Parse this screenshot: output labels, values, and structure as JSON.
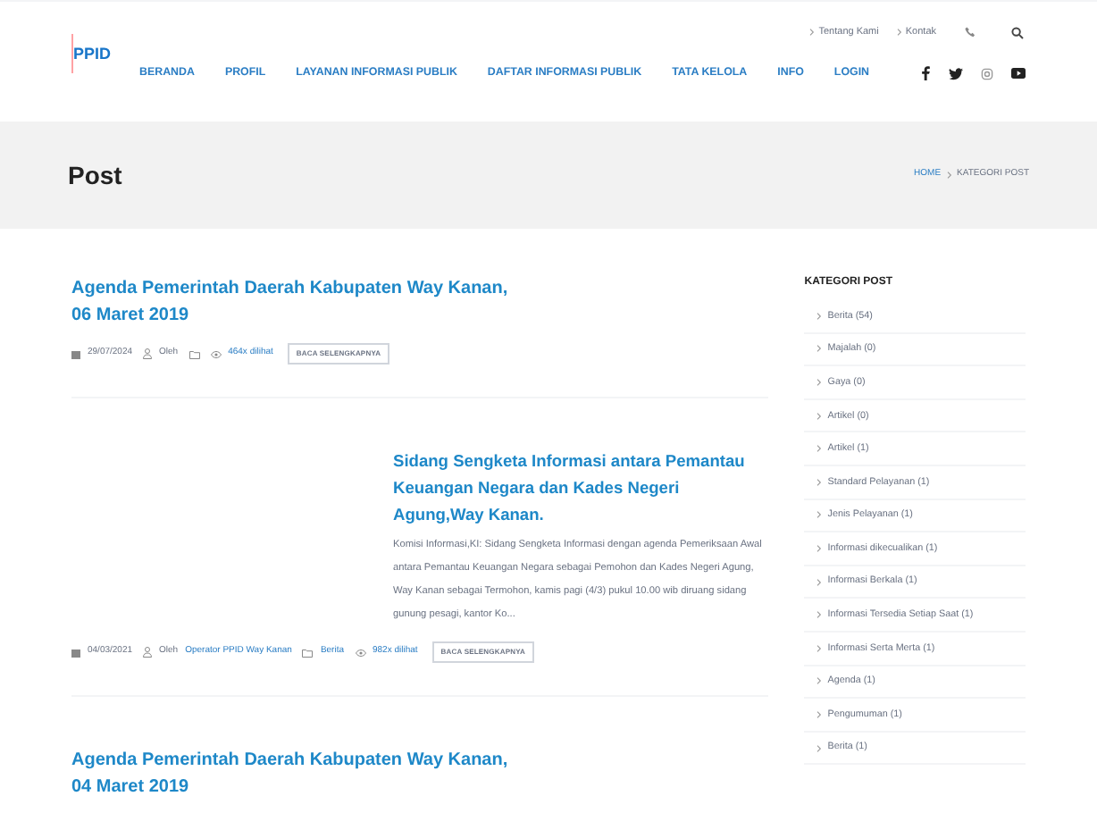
{
  "logo": {
    "text": "PPID"
  },
  "top_links": [
    {
      "label": "Tentang Kami"
    },
    {
      "label": "Kontak"
    }
  ],
  "nav": [
    {
      "label": "BERANDA"
    },
    {
      "label": "PROFIL"
    },
    {
      "label": "LAYANAN INFORMASI PUBLIK"
    },
    {
      "label": "DAFTAR INFORMASI PUBLIK"
    },
    {
      "label": "TATA KELOLA"
    },
    {
      "label": "INFO"
    },
    {
      "label": "LOGIN"
    }
  ],
  "social": [
    {
      "kind": "facebook"
    },
    {
      "kind": "twitter"
    },
    {
      "kind": "instagram"
    },
    {
      "kind": "youtube"
    }
  ],
  "page_title": "Post",
  "breadcrumb": [
    {
      "label": "HOME"
    },
    {
      "label": "KATEGORI POST"
    }
  ],
  "posts": [
    {
      "title": "Agenda Pemerintah Daerah Kabupaten Way Kanan, 06 Maret 2019",
      "date": "29/07/2024",
      "author_label": "Oleh",
      "views": "464x dilihat",
      "button": "BACA SELENGKAPNYA"
    },
    {
      "title": "Sidang Sengketa Informasi antara Pemantau Keuangan Negara dan Kades Negeri Agung,Way Kanan.",
      "excerpt": "Komisi Informasi,KI: Sidang Sengketa Informasi dengan agenda Pemeriksaan Awal antara Pemantau Keuangan Negara sebagai Pemohon dan Kades Negeri Agung, Way Kanan sebagai Termohon, kamis pagi (4/3) pukul 10.00 wib diruang sidang gunung pesagi, kantor Ko...",
      "date": "04/03/2021",
      "author_label": "Oleh",
      "author": "Operator PPID Way Kanan",
      "category": "Berita",
      "views": "982x dilihat",
      "button": "BACA SELENGKAPNYA"
    },
    {
      "title": "Agenda Pemerintah Daerah Kabupaten Way Kanan, 04 Maret 2019"
    }
  ],
  "sidebar": {
    "title": "KATEGORI POST",
    "items": [
      "Berita (54)",
      "Majalah (0)",
      "Gaya (0)",
      "Artikel (0)",
      "Artikel (1)",
      "Standard Pelayanan (1)",
      "Jenis Pelayanan (1)",
      "Informasi dikecualikan (1)",
      "Informasi Berkala (1)",
      "Informasi Tersedia Setiap Saat (1)",
      "Informasi Serta Merta (1)",
      "Agenda (1)",
      "Pengumuman (1)",
      "Berita (1)"
    ]
  }
}
